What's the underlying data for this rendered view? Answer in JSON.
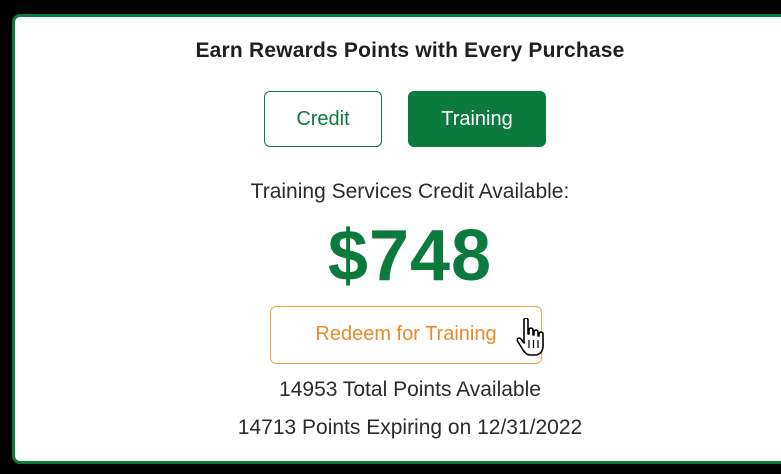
{
  "rewards": {
    "title": "Earn Rewards Points with Every Purchase",
    "tabs": [
      {
        "label": "Credit",
        "active": false
      },
      {
        "label": "Training",
        "active": true
      }
    ],
    "credit_label": "Training Services Credit Available:",
    "amount": "$748",
    "redeem_label": "Redeem for Training",
    "total_points": "14953 Total Points Available",
    "expiring_points": "14713 Points Expiring on 12/31/2022"
  },
  "colors": {
    "brand_green": "#0b7a3f",
    "redeem_orange": "#ec8a2a",
    "frame": "#000000"
  },
  "icons": {
    "cursor": "hand-pointer-icon"
  }
}
